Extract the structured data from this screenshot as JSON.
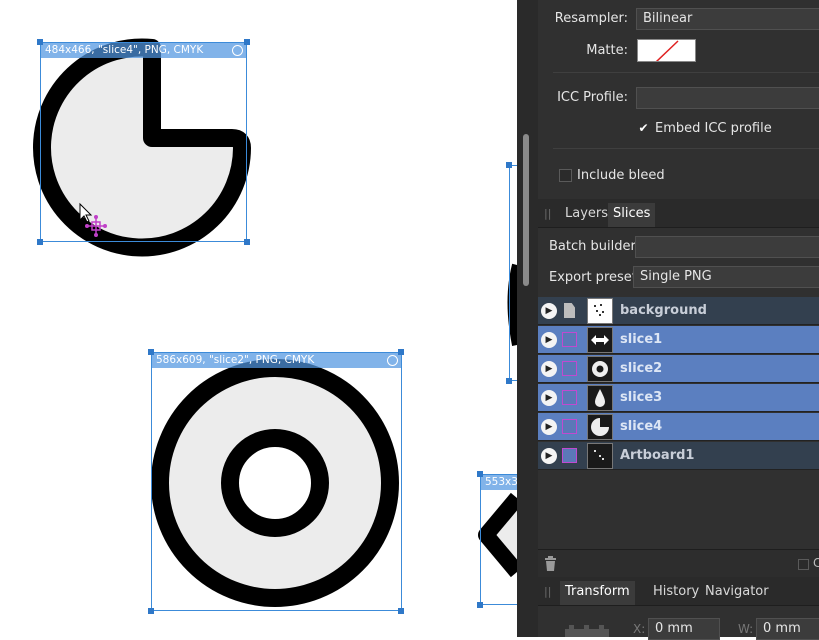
{
  "canvas": {
    "slices": [
      {
        "label": "484x466, \"slice4\", PNG, CMYK"
      },
      {
        "label": "586x609, \"slice2\", PNG, CMYK"
      },
      {
        "label": "553x3"
      }
    ]
  },
  "export_panel": {
    "resampler": {
      "label": "Resampler:",
      "value": "Bilinear"
    },
    "matte": {
      "label": "Matte:"
    },
    "icc_profile": {
      "label": "ICC Profile:",
      "value": ""
    },
    "embed_icc": {
      "label": "Embed ICC profile",
      "checked": true
    },
    "include_bleed": {
      "label": "Include bleed",
      "checked": false
    }
  },
  "slices_panel": {
    "tabs": [
      {
        "label": "Layers",
        "active": false
      },
      {
        "label": "Slices",
        "active": true
      }
    ],
    "batch_builder": {
      "label": "Batch builder:",
      "value": ""
    },
    "export_preset": {
      "label": "Export preset:",
      "value": "Single PNG"
    },
    "rows": [
      {
        "name": "background",
        "selected": false,
        "icon": "document-icon"
      },
      {
        "name": "slice1",
        "selected": true,
        "icon": "slice-icon"
      },
      {
        "name": "slice2",
        "selected": true,
        "icon": "slice-icon"
      },
      {
        "name": "slice3",
        "selected": true,
        "icon": "slice-icon"
      },
      {
        "name": "slice4",
        "selected": true,
        "icon": "slice-icon"
      },
      {
        "name": "Artboard1",
        "selected": false,
        "icon": "slice-icon"
      }
    ]
  },
  "bottom_panel": {
    "tabs": [
      {
        "label": "Transform",
        "active": true
      },
      {
        "label": "History",
        "active": false
      },
      {
        "label": "Navigator",
        "active": false
      }
    ],
    "x": {
      "label": "X:",
      "value": "0 mm"
    },
    "w": {
      "label": "W:",
      "value": "0 mm"
    }
  },
  "colors": {
    "panel_bg": "#303030",
    "selection_blue": "#5b7fc0",
    "slice_border": "#3c8bd9",
    "shape_fill": "#ececec",
    "shape_stroke": "#000000",
    "transform_handle": "#c040c8"
  }
}
